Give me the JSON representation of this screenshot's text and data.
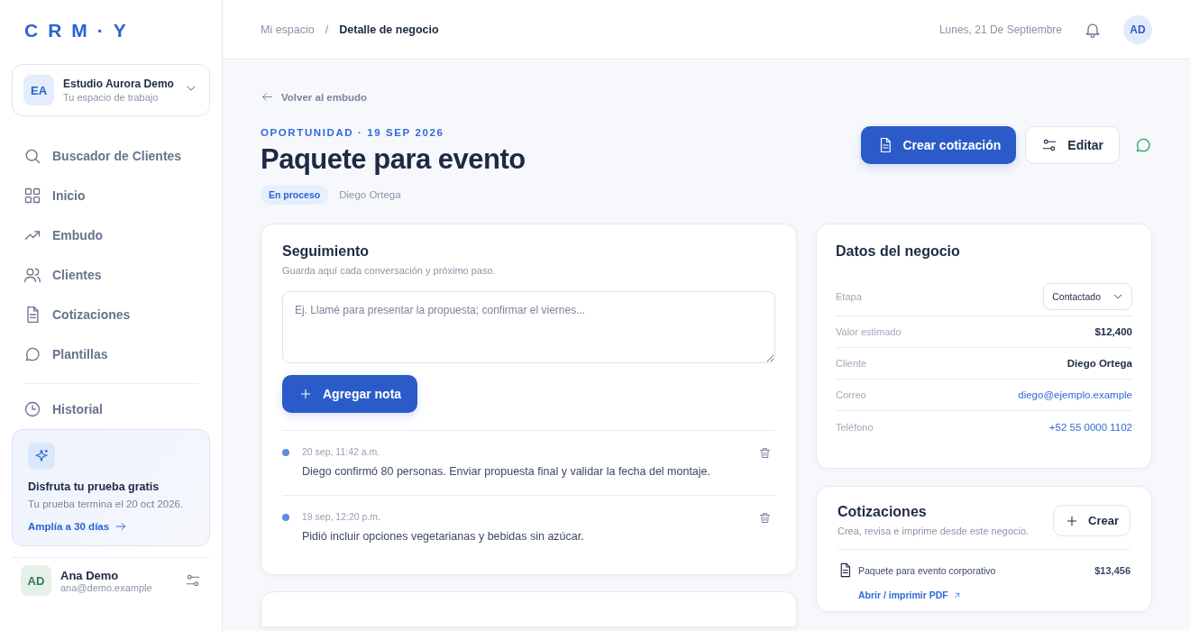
{
  "sidebar": {
    "logo": "CRM·Y",
    "workspace": {
      "initials": "EA",
      "name": "Estudio Aurora Demo",
      "subtitle": "Tu espacio de trabajo"
    },
    "nav_items": [
      {
        "label": "Buscador de Clientes",
        "selected": false
      },
      {
        "label": "Inicio",
        "selected": false
      },
      {
        "label": "Embudo",
        "selected": false
      },
      {
        "label": "Clientes",
        "selected": false
      },
      {
        "label": "Cotizaciones",
        "selected": false
      },
      {
        "label": "Plantillas",
        "selected": false
      }
    ],
    "secondary_items": [
      {
        "label": "Historial",
        "selected": false
      }
    ],
    "trial": {
      "title": "Disfruta tu prueba gratis",
      "text": "Tu prueba termina el 20 oct 2026.",
      "link": "Amplía a 30 días"
    },
    "user": {
      "initials": "AD",
      "name": "Ana Demo",
      "email": "ana@demo.example"
    }
  },
  "topbar": {
    "breadcrumb": [
      "Mi espacio",
      "/",
      "Detalle de negocio"
    ],
    "date": "Lunes, 21 De Septiembre",
    "avatar": "AD"
  },
  "header": {
    "back_link": "Volver al embudo",
    "eyebrow": "OPORTUNIDAD · 19 SEP 2026",
    "title": "Paquete para evento",
    "status": "En proceso",
    "owner": "Diego Ortega",
    "buttons": [
      {
        "label": "Crear cotización",
        "kind": "primary"
      },
      {
        "label": "Editar",
        "kind": "secondary"
      }
    ]
  },
  "followup": {
    "title": "Seguimiento",
    "subtitle": "Guarda aquí cada conversación y próximo paso.",
    "placeholder": "Ej. Llamé para presentar la propuesta; confirmar el viernes...",
    "button": "Agregar nota",
    "notes": [
      {
        "time": "20 sep, 11:42 a.m.",
        "text": "Diego confirmó 80 personas. Enviar propuesta final y validar la fecha del montaje.",
        "color": "#5b8fdc"
      },
      {
        "time": "19 sep, 12:20 p.m.",
        "text": "Pidió incluir opciones vegetarianas y bebidas sin azúcar.",
        "color": "#5b8fdc"
      }
    ]
  },
  "deal": {
    "title": "Datos del negocio",
    "rows": [
      {
        "label": "Etapa",
        "kind": "select",
        "value": "Contactado"
      },
      {
        "label": "Valor estimado",
        "kind": "strong",
        "value": "$12,400"
      },
      {
        "label": "Cliente",
        "kind": "strong",
        "value": "Diego Ortega"
      },
      {
        "label": "Correo",
        "kind": "link",
        "value": "diego@ejemplo.example"
      },
      {
        "label": "Teléfono",
        "kind": "link",
        "value": "+52 55 0000 1102"
      }
    ]
  },
  "quotes": {
    "title": "Cotizaciones",
    "subtitle": "Crea, revisa e imprime desde este negocio.",
    "button": "Crear",
    "items": [
      {
        "name": "Paquete para evento corporativo",
        "amount": "$13,456",
        "link": "Abrir / imprimir PDF"
      }
    ]
  }
}
